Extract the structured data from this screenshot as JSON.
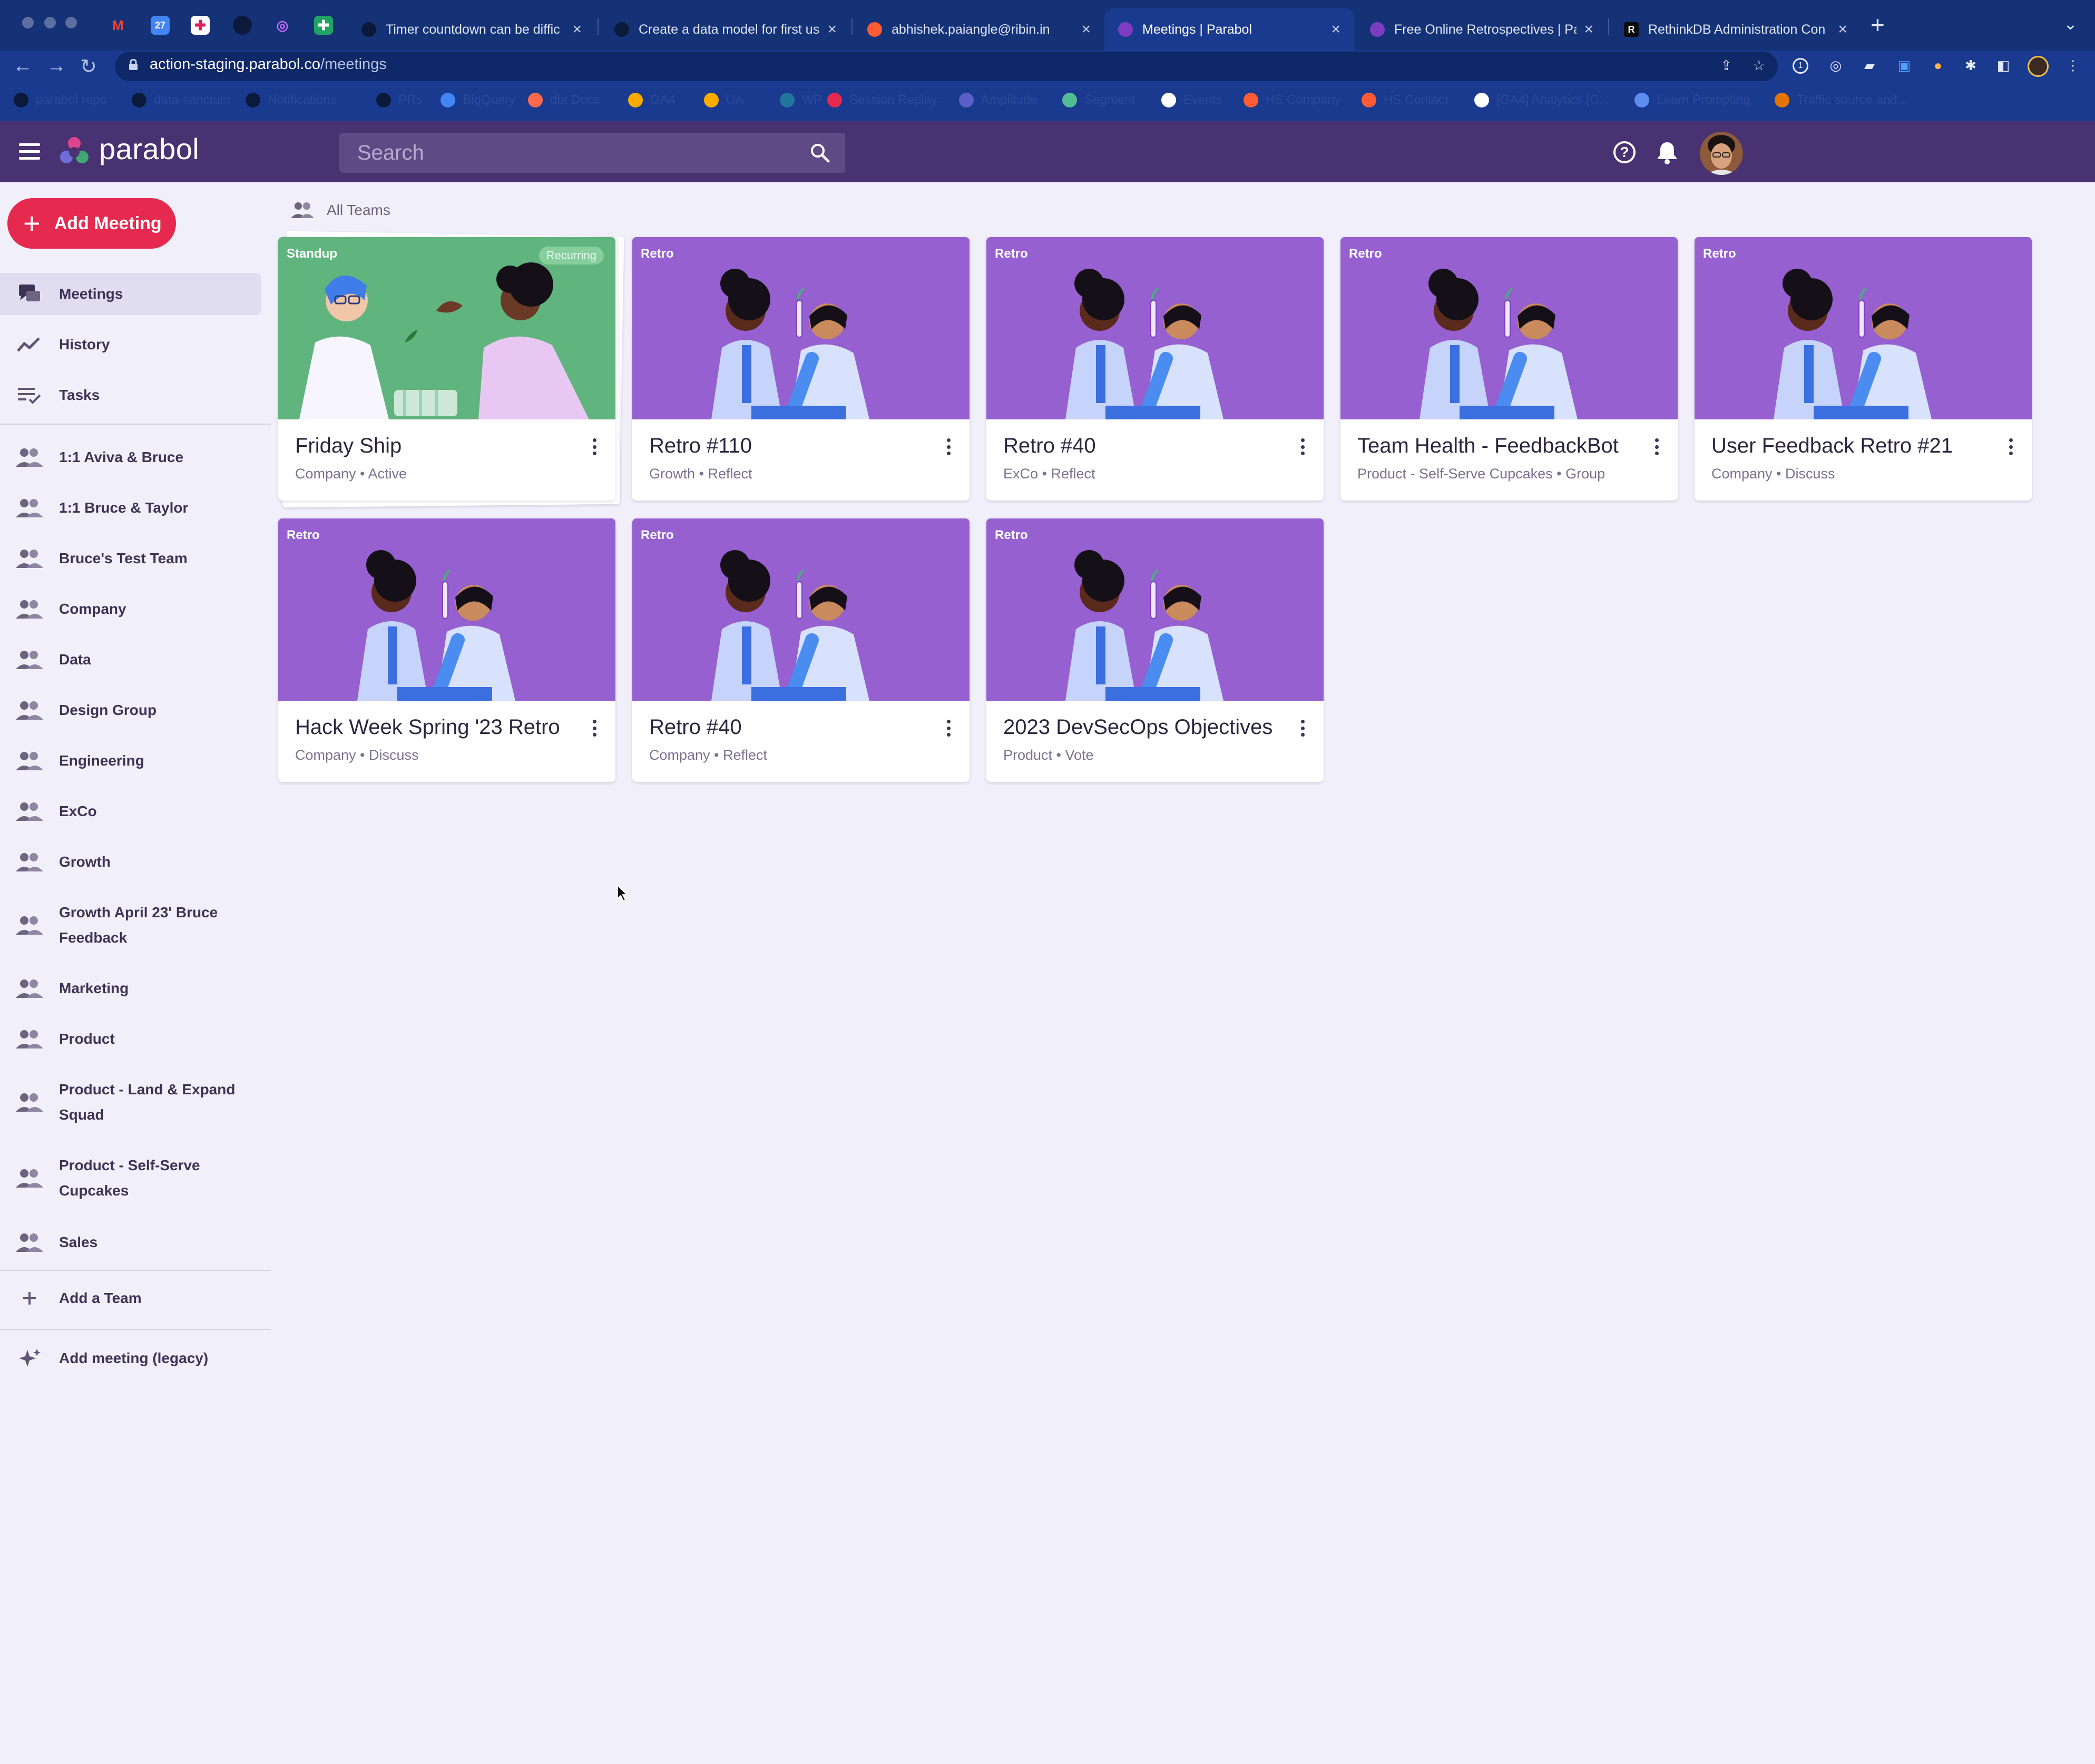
{
  "browser": {
    "tabs": [
      {
        "title": "Timer countdown can be diffic",
        "close": "×"
      },
      {
        "title": "Create a data model for first us",
        "close": "×"
      },
      {
        "title": "abhishek.paiangle@ribin.in",
        "close": "×"
      },
      {
        "title": "Meetings | Parabol",
        "close": "×"
      },
      {
        "title": "Free Online Retrospectives | Pa",
        "close": "×"
      },
      {
        "title": "RethinkDB Administration Con",
        "close": "×"
      }
    ],
    "new_tab": "+",
    "tab_menu": "⌄",
    "url_host": "action-staging.parabol.co",
    "url_path": "/meetings",
    "bookmarks": [
      "parabol repo",
      "data-sanctum",
      "Notifications",
      "PRs",
      "BigQuery",
      "dbt Docs",
      "GA4",
      "UA",
      "WP",
      "Session Replay",
      "Amplitude",
      "Segment",
      "Events",
      "HS Company",
      "HS Contact",
      "[GA4] Analytics (C...",
      "Learn Prompting",
      "Traffic source and..."
    ]
  },
  "app": {
    "logo": "parabol",
    "search_placeholder": "Search"
  },
  "sidebar": {
    "add_meeting": "Add Meeting",
    "nav": [
      {
        "label": "Meetings",
        "icon": "meetings-icon"
      },
      {
        "label": "History",
        "icon": "history-icon"
      },
      {
        "label": "Tasks",
        "icon": "tasks-icon"
      }
    ],
    "teams": [
      "1:1 Aviva & Bruce",
      "1:1 Bruce & Taylor",
      "Bruce's Test Team",
      "Company",
      "Data",
      "Design Group",
      "Engineering",
      "ExCo",
      "Growth",
      "Growth April 23' Bruce Feedback",
      "Marketing",
      "Product",
      "Product - Land & Expand Squad",
      "Product - Self-Serve Cupcakes",
      "Sales"
    ],
    "add_team": "Add a Team",
    "add_legacy": "Add meeting (legacy)"
  },
  "main": {
    "filter_label": "All Teams",
    "meetings": [
      {
        "type": "Standup",
        "badge": "Recurring",
        "title": "Friday Ship",
        "subtitle": "Company • Active"
      },
      {
        "type": "Retro",
        "title": "Retro #110",
        "subtitle": "Growth • Reflect"
      },
      {
        "type": "Retro",
        "title": "Retro #40",
        "subtitle": "ExCo • Reflect"
      },
      {
        "type": "Retro",
        "title": "Team Health - FeedbackBot",
        "subtitle": "Product - Self-Serve Cupcakes • Group"
      },
      {
        "type": "Retro",
        "title": "User Feedback Retro #21",
        "subtitle": "Company • Discuss"
      },
      {
        "type": "Retro",
        "title": "Hack Week Spring '23 Retro",
        "subtitle": "Company • Discuss"
      },
      {
        "type": "Retro",
        "title": "Retro #40",
        "subtitle": "Company • Reflect"
      },
      {
        "type": "Retro",
        "title": "2023 DevSecOps Objectives",
        "subtitle": "Product • Vote"
      }
    ]
  },
  "colors": {
    "header": "#493272",
    "accent": "#e5294f",
    "retro_art": "#9660d0",
    "standup_art": "#5fb57d"
  }
}
